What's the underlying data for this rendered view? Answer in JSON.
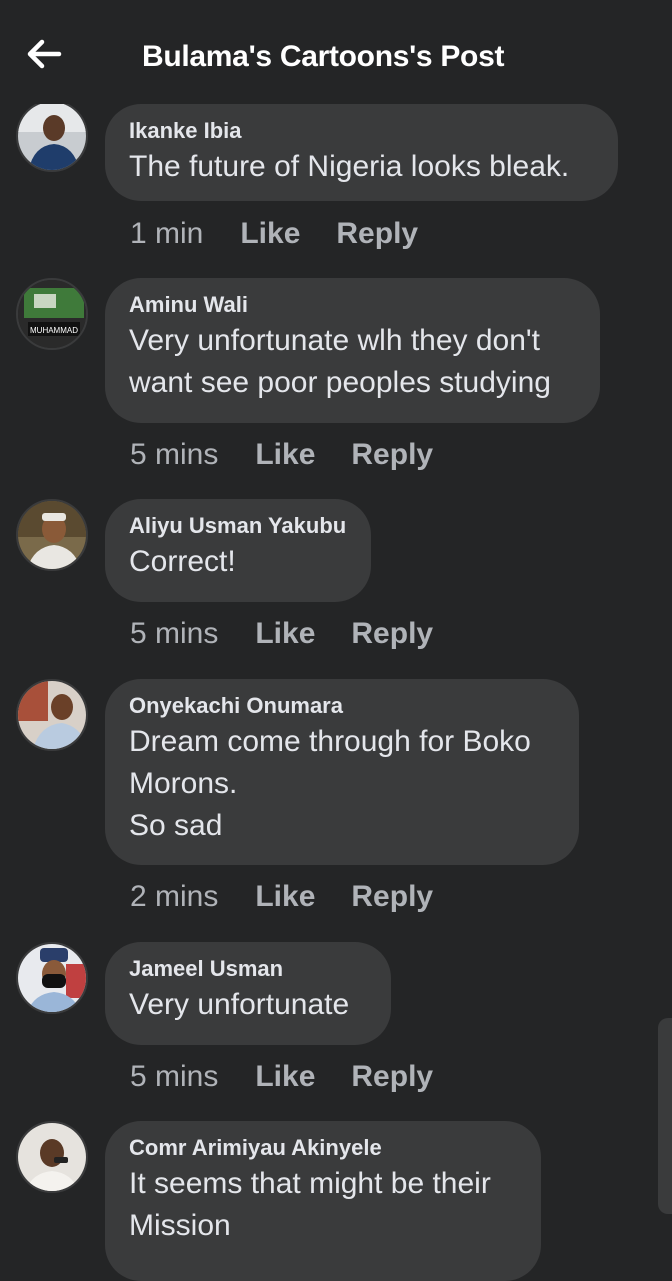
{
  "header": {
    "title": "Bulama's Cartoons's Post"
  },
  "comments": [
    {
      "author": "Ikanke Ibia",
      "lines": [
        "The future of Nigeria looks bleak."
      ],
      "time": "1 min",
      "like": "Like",
      "reply": "Reply"
    },
    {
      "author": "Aminu Wali",
      "lines": [
        "Very unfortunate wlh they don't",
        "want see poor peoples studying"
      ],
      "time": "5 mins",
      "like": "Like",
      "reply": "Reply"
    },
    {
      "author": "Aliyu Usman Yakubu",
      "lines": [
        "Correct!"
      ],
      "time": "5 mins",
      "like": "Like",
      "reply": "Reply"
    },
    {
      "author": "Onyekachi Onumara",
      "lines": [
        "Dream come through for Boko",
        "Morons.",
        "So sad"
      ],
      "time": "2 mins",
      "like": "Like",
      "reply": "Reply"
    },
    {
      "author": "Jameel Usman",
      "lines": [
        "Very unfortunate"
      ],
      "time": "5 mins",
      "like": "Like",
      "reply": "Reply"
    },
    {
      "author": "Comr Arimiyau Akinyele",
      "lines": [
        "It seems that might be their",
        "Mission"
      ]
    }
  ],
  "avatar2_text": {
    "line1": "MUHAMMAD"
  },
  "colors": {
    "background": "#242526",
    "bubble": "#3a3b3c",
    "text_primary": "#e4e6eb",
    "text_secondary": "#b0b3b8"
  },
  "icons": {
    "back": "arrow-left-icon"
  }
}
